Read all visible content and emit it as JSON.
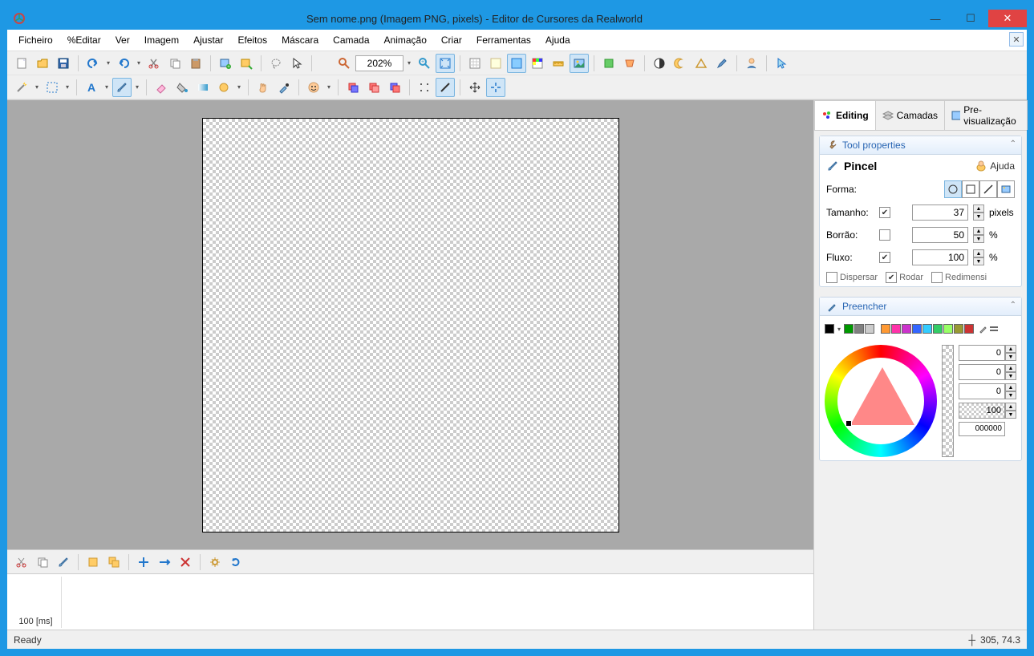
{
  "title": "Sem nome.png (Imagem PNG, pixels) - Editor de Cursores da Realworld",
  "menu": [
    "Ficheiro",
    "%Editar",
    "Ver",
    "Imagem",
    "Ajustar",
    "Efeitos",
    "Máscara",
    "Camada",
    "Animação",
    "Criar",
    "Ferramentas",
    "Ajuda"
  ],
  "zoom": "202%",
  "frames": {
    "duration": "100 [ms]"
  },
  "status": {
    "left": "Ready",
    "coords": "305, 74.3"
  },
  "sidepanel": {
    "tabs": [
      "Editing",
      "Camadas",
      "Pre-visualização"
    ],
    "tool_props_header": "Tool properties",
    "tool_name": "Pincel",
    "help_label": "Ajuda",
    "forma_label": "Forma:",
    "tamanho_label": "Tamanho:",
    "tamanho_value": "37",
    "tamanho_unit": "pixels",
    "borrao_label": "Borrão:",
    "borrao_value": "50",
    "borrao_unit": "%",
    "fluxo_label": "Fluxo:",
    "fluxo_value": "100",
    "fluxo_unit": "%",
    "disp_label": "Dispersar",
    "rodar_label": "Rodar",
    "redim_label": "Redimensi",
    "fill_header": "Preencher",
    "color_vals": [
      "0",
      "0",
      "0",
      "100"
    ],
    "hex": "000000"
  },
  "swatches": [
    "#000000",
    "#009900",
    "#808080",
    "#cccccc",
    "",
    "#ff9933",
    "#ff33aa",
    "#cc33cc",
    "#3366ff",
    "#33ccff",
    "#33cc66",
    "#99ff66",
    "#999933",
    "#cc3333"
  ]
}
